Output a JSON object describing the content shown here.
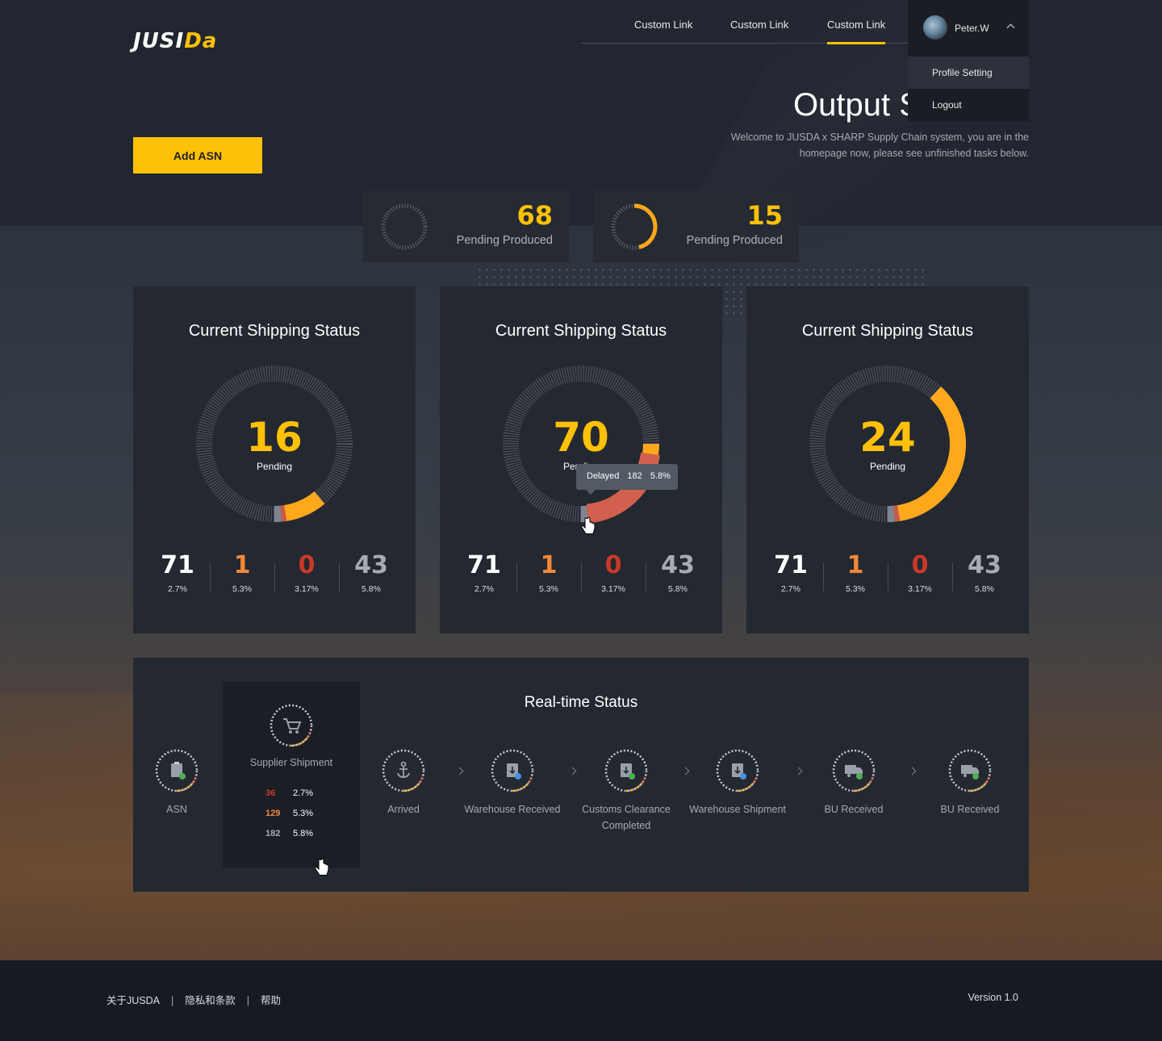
{
  "brand": {
    "logo_text_1": "JUSI",
    "logo_text_2": "Da",
    "accent_color": "#ffc107"
  },
  "nav": {
    "links": [
      "Custom Link",
      "Custom Link",
      "Custom Link"
    ],
    "active_index": 2
  },
  "user": {
    "name": "Peter.W",
    "menu": [
      "Profile Setting",
      "Logout"
    ]
  },
  "page": {
    "title": "Output Status",
    "welcome": "Welcome to JUSDA x SHARP Supply Chain system, you are in the homepage now, please see unfinished tasks below.",
    "add_button": "Add ASN"
  },
  "pending": [
    {
      "value": "68",
      "label": "Pending Produced",
      "progress": 0.0
    },
    {
      "value": "15",
      "label": "Pending Produced",
      "progress": 0.45
    }
  ],
  "status_cards": [
    {
      "title": "Current Shipping Status",
      "value": "16",
      "label": "Pending",
      "stats": [
        {
          "v": "71",
          "p": "2.7%"
        },
        {
          "v": "1",
          "p": "5.3%"
        },
        {
          "v": "0",
          "p": "3.17%"
        },
        {
          "v": "43",
          "p": "5.8%"
        }
      ]
    },
    {
      "title": "Current Shipping Status",
      "value": "70",
      "label": "Pending",
      "stats": [
        {
          "v": "71",
          "p": "2.7%"
        },
        {
          "v": "1",
          "p": "5.3%"
        },
        {
          "v": "0",
          "p": "3.17%"
        },
        {
          "v": "43",
          "p": "5.8%"
        }
      ]
    },
    {
      "title": "Current Shipping Status",
      "value": "24",
      "label": "Pending",
      "stats": [
        {
          "v": "71",
          "p": "2.7%"
        },
        {
          "v": "1",
          "p": "5.3%"
        },
        {
          "v": "0",
          "p": "3.17%"
        },
        {
          "v": "43",
          "p": "5.8%"
        }
      ]
    }
  ],
  "tooltip": {
    "label": "Delayed",
    "value": "182",
    "percent": "5.8%"
  },
  "realtime": {
    "title": "Real-time Status",
    "steps": [
      "ASN",
      "Arrived",
      "Warehouse Received",
      "Customs Clearance Completed",
      "Warehouse Shipment",
      "BU Received",
      "BU Received"
    ],
    "supplier": {
      "label": "Supplier Shipment",
      "rows": [
        {
          "v": "36",
          "p": "2.7%"
        },
        {
          "v": "129",
          "p": "5.3%"
        },
        {
          "v": "182",
          "p": "5.8%"
        }
      ]
    }
  },
  "footer": {
    "links": [
      "关于JUSDA",
      "隐私和条款",
      "帮助"
    ],
    "version": "Version 1.0"
  }
}
